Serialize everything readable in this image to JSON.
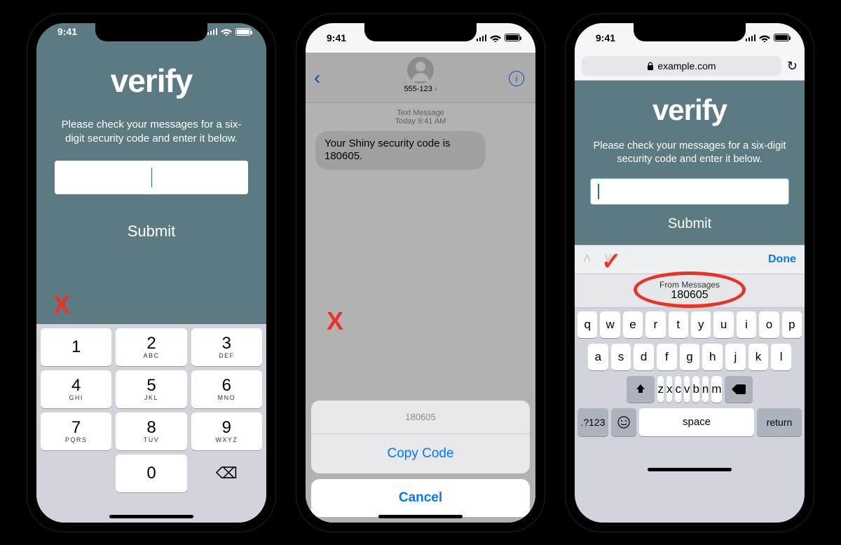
{
  "statusbar": {
    "time": "9:41"
  },
  "verify": {
    "title": "verify",
    "subtitle": "Please check your messages for a six-digit security code and enter it below.",
    "subtitle_wrapped": "Please check your messages for a six-digit security code and enter it below.",
    "submit": "Submit"
  },
  "numpad": {
    "keys": [
      {
        "digit": "1",
        "letters": ""
      },
      {
        "digit": "2",
        "letters": "ABC"
      },
      {
        "digit": "3",
        "letters": "DEF"
      },
      {
        "digit": "4",
        "letters": "GHI"
      },
      {
        "digit": "5",
        "letters": "JKL"
      },
      {
        "digit": "6",
        "letters": "MNO"
      },
      {
        "digit": "7",
        "letters": "PQRS"
      },
      {
        "digit": "8",
        "letters": "TUV"
      },
      {
        "digit": "9",
        "letters": "WXYZ"
      },
      {
        "digit": "",
        "letters": ""
      },
      {
        "digit": "0",
        "letters": ""
      },
      {
        "digit": "⌫",
        "letters": ""
      }
    ]
  },
  "messages": {
    "contact": "555-123",
    "metaLabel": "Text Message",
    "metaTime": "Today 9:41 AM",
    "body": "Your Shiny security code is 180605.",
    "sheetCode": "180605",
    "copy": "Copy Code",
    "cancel": "Cancel"
  },
  "safari": {
    "url": "example.com"
  },
  "accessory": {
    "done": "Done"
  },
  "suggestion": {
    "label": "From Messages",
    "code": "180605"
  },
  "qwerty": {
    "row1": [
      "q",
      "w",
      "e",
      "r",
      "t",
      "y",
      "u",
      "i",
      "o",
      "p"
    ],
    "row2": [
      "a",
      "s",
      "d",
      "f",
      "g",
      "h",
      "j",
      "k",
      "l"
    ],
    "row3": [
      "z",
      "x",
      "c",
      "v",
      "b",
      "n",
      "m"
    ],
    "numSwitch": ".?123",
    "space": "space",
    "return": "return"
  },
  "annotations": {
    "x": "X",
    "check": "✓"
  }
}
